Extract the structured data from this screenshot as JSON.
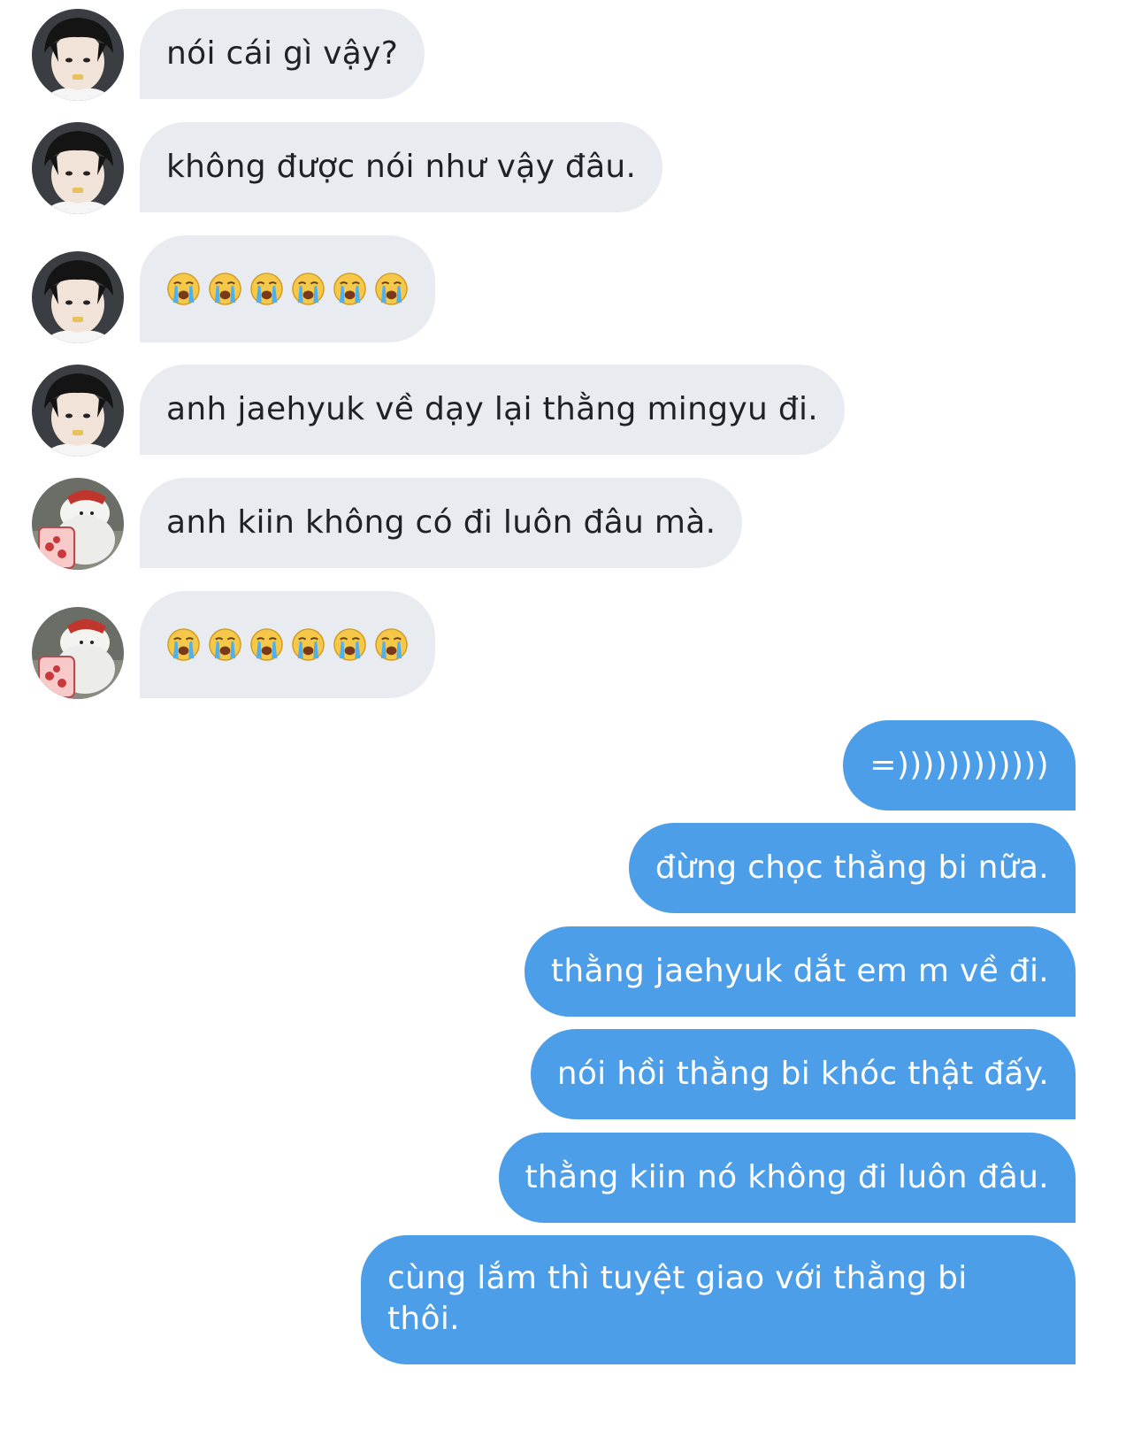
{
  "conversation": {
    "messages": [
      {
        "sender": "user-a",
        "direction": "incoming",
        "text": "nói cái gì vậy?"
      },
      {
        "sender": "user-a",
        "direction": "incoming",
        "text": "không được nói như vậy đâu."
      },
      {
        "sender": "user-a",
        "direction": "incoming",
        "emoji": [
          "loudly-crying-face",
          "loudly-crying-face",
          "loudly-crying-face",
          "loudly-crying-face",
          "loudly-crying-face",
          "loudly-crying-face"
        ]
      },
      {
        "sender": "user-a",
        "direction": "incoming",
        "text": "anh jaehyuk về dạy lại thằng mingyu đi."
      },
      {
        "sender": "user-b",
        "direction": "incoming",
        "text": "anh kiin không có đi luôn đâu mà."
      },
      {
        "sender": "user-b",
        "direction": "incoming",
        "emoji": [
          "loudly-crying-face",
          "loudly-crying-face",
          "loudly-crying-face",
          "loudly-crying-face",
          "loudly-crying-face",
          "loudly-crying-face"
        ]
      },
      {
        "sender": "me",
        "direction": "outgoing",
        "text": "=))))))))))))"
      },
      {
        "sender": "me",
        "direction": "outgoing",
        "text": "đừng chọc thằng bi nữa."
      },
      {
        "sender": "me",
        "direction": "outgoing",
        "text": "thằng jaehyuk dắt em m về đi."
      },
      {
        "sender": "me",
        "direction": "outgoing",
        "text": "nói hồi thằng bi khóc thật đấy."
      },
      {
        "sender": "me",
        "direction": "outgoing",
        "text": "thằng kiin nó không đi luôn đâu."
      },
      {
        "sender": "me",
        "direction": "outgoing",
        "text": "cùng lắm thì tuyệt giao với thằng bi thôi."
      }
    ]
  },
  "colors": {
    "incoming_bubble": "#e8ecf0",
    "incoming_text": "#1d2226",
    "outgoing_bubble": "#4c9ee8",
    "outgoing_text": "#ffffff",
    "background": "#ffffff"
  },
  "icons": {
    "avatar_a": "profile-photo-dark-hair-avatar",
    "avatar_b": "cartoon-polar-bear-avatar",
    "emoji": "loudly-crying-face"
  }
}
